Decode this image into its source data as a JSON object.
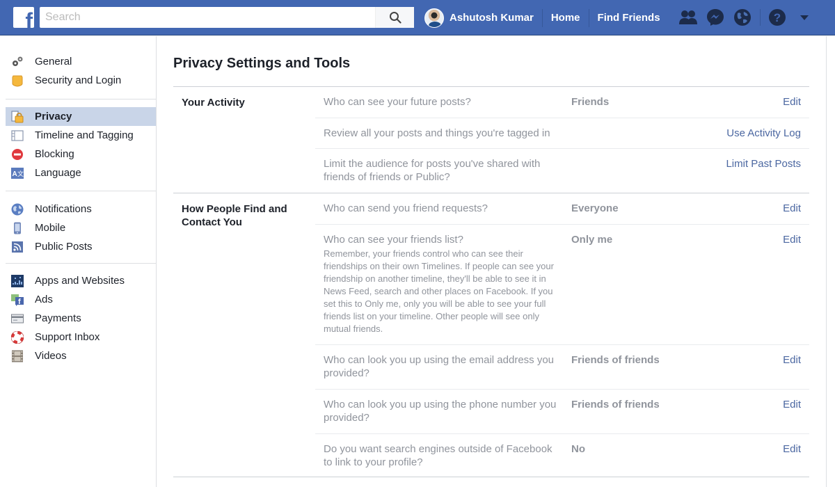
{
  "topbar": {
    "logo": "f",
    "search_placeholder": "Search",
    "search_value": "",
    "user_name": "Ashutosh Kumar",
    "nav_links": [
      "Home",
      "Find Friends"
    ],
    "icons": [
      "friend-requests-icon",
      "messenger-icon",
      "notifications-globe-icon",
      "help-icon",
      "account-menu-caret-icon"
    ]
  },
  "sidebar": {
    "groups": [
      [
        {
          "label": "General",
          "icon": "gears-icon"
        },
        {
          "label": "Security and Login",
          "icon": "shield-badge-icon"
        }
      ],
      [
        {
          "label": "Privacy",
          "icon": "privacy-lock-icon",
          "active": true
        },
        {
          "label": "Timeline and Tagging",
          "icon": "timeline-icon"
        },
        {
          "label": "Blocking",
          "icon": "block-icon"
        },
        {
          "label": "Language",
          "icon": "language-icon"
        }
      ],
      [
        {
          "label": "Notifications",
          "icon": "globe-icon"
        },
        {
          "label": "Mobile",
          "icon": "mobile-phone-icon"
        },
        {
          "label": "Public Posts",
          "icon": "rss-icon"
        }
      ],
      [
        {
          "label": "Apps and Websites",
          "icon": "apps-grid-icon"
        },
        {
          "label": "Ads",
          "icon": "ads-icon"
        },
        {
          "label": "Payments",
          "icon": "credit-card-icon"
        },
        {
          "label": "Support Inbox",
          "icon": "lifebuoy-icon"
        },
        {
          "label": "Videos",
          "icon": "film-strip-icon"
        }
      ]
    ]
  },
  "main": {
    "title": "Privacy Settings and Tools",
    "sections": [
      {
        "label": "Your Activity",
        "rows": [
          {
            "question": "Who can see your future posts?",
            "value": "Friends",
            "action": "Edit"
          },
          {
            "question": "Review all your posts and things you're tagged in",
            "value": "",
            "action": "Use Activity Log"
          },
          {
            "question": "Limit the audience for posts you've shared with friends of friends or Public?",
            "value": "",
            "action": "Limit Past Posts"
          }
        ]
      },
      {
        "label": "How People Find and Contact You",
        "rows": [
          {
            "question": "Who can send you friend requests?",
            "value": "Everyone",
            "action": "Edit"
          },
          {
            "question": "Who can see your friends list?",
            "description": "Remember, your friends control who can see their friendships on their own Timelines. If people can see your friendship on another timeline, they'll be able to see it in News Feed, search and other places on Facebook. If you set this to Only me, only you will be able to see your full friends list on your timeline. Other people will see only mutual friends.",
            "value": "Only me",
            "action": "Edit"
          },
          {
            "question": "Who can look you up using the email address you provided?",
            "value": "Friends of friends",
            "action": "Edit"
          },
          {
            "question": "Who can look you up using the phone number you provided?",
            "value": "Friends of friends",
            "action": "Edit"
          },
          {
            "question": "Do you want search engines outside of Facebook to link to your profile?",
            "value": "No",
            "action": "Edit"
          }
        ]
      }
    ]
  },
  "colors": {
    "brand_blue": "#4267b2",
    "link": "#4b67a1",
    "muted_text": "#90949c",
    "active_item_bg": "#c9d5e8"
  }
}
